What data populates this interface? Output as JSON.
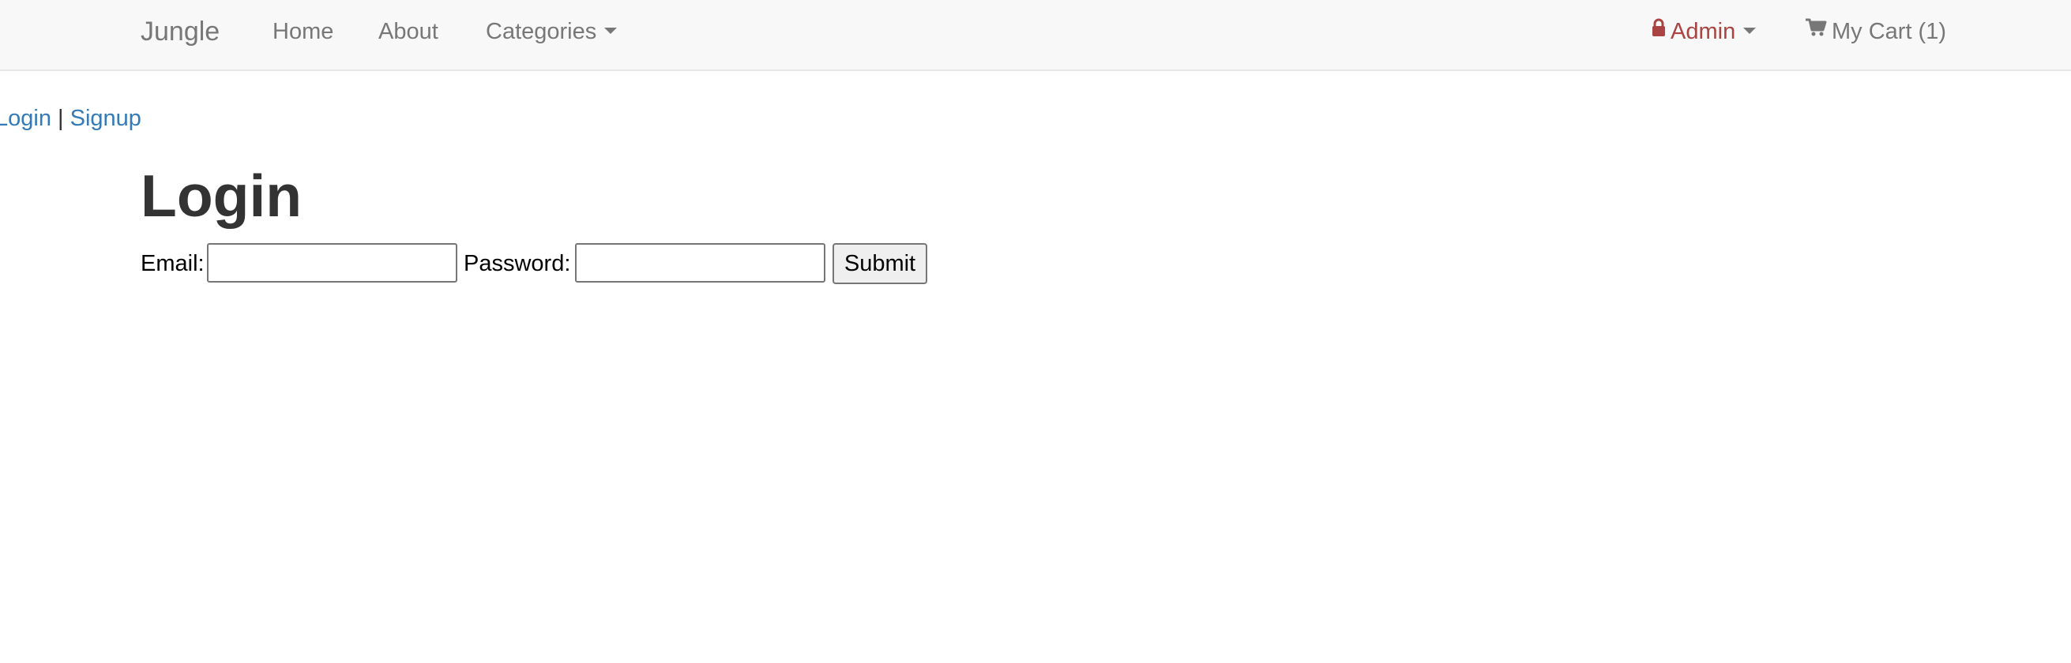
{
  "navbar": {
    "brand": "Jungle",
    "links": {
      "home": "Home",
      "about": "About",
      "categories": "Categories"
    },
    "admin_label": "Admin",
    "cart_label": "My Cart (1)",
    "icons": {
      "admin": "lock-icon",
      "cart": "shopping-cart-icon",
      "dropdown": "caret-down-icon"
    }
  },
  "auth_links": {
    "login": "Login",
    "separator": "|",
    "signup": "Signup"
  },
  "page": {
    "title": "Login"
  },
  "form": {
    "email_label": "Email:",
    "email_value": "",
    "password_label": "Password:",
    "password_value": "",
    "submit_label": "Submit"
  },
  "colors": {
    "navbar_bg": "#f8f8f8",
    "nav_text": "#777777",
    "admin": "#a94442",
    "link": "#337ab7",
    "heading": "#333333"
  }
}
